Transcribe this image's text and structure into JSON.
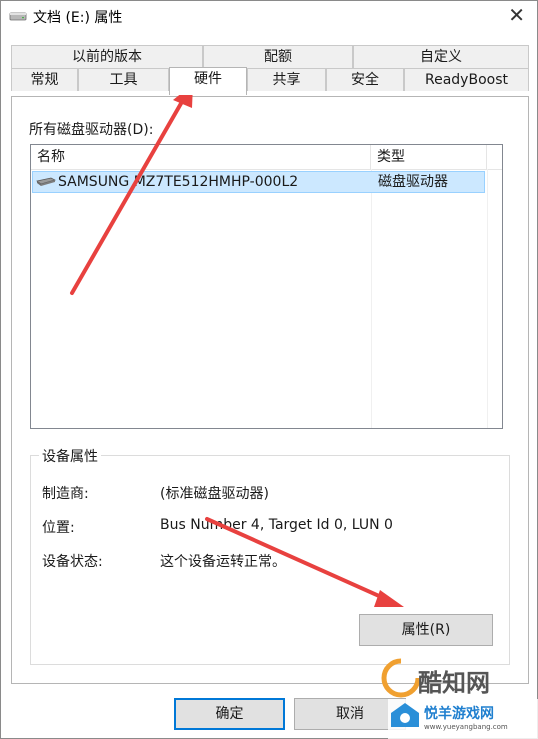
{
  "window": {
    "title": "文档 (E:) 属性",
    "close_glyph": "✕"
  },
  "tabs": {
    "row1": [
      {
        "label": "以前的版本"
      },
      {
        "label": "配额"
      },
      {
        "label": "自定义"
      }
    ],
    "row2": [
      {
        "label": "常规"
      },
      {
        "label": "工具"
      },
      {
        "label": "硬件",
        "active": true
      },
      {
        "label": "共享"
      },
      {
        "label": "安全"
      },
      {
        "label": "ReadyBoost"
      }
    ]
  },
  "hardware": {
    "drives_label": "所有磁盘驱动器(D):",
    "columns": [
      "名称",
      "类型"
    ],
    "rows": [
      {
        "name": "SAMSUNG MZ7TE512HMHP-000L2",
        "type": "磁盘驱动器",
        "icon": "disk-drive-icon",
        "selected": true
      }
    ],
    "device_properties": {
      "title": "设备属性",
      "manufacturer_label": "制造商:",
      "manufacturer_value": "(标准磁盘驱动器)",
      "location_label": "位置:",
      "location_value": "Bus Number 4, Target Id 0, LUN 0",
      "status_label": "设备状态:",
      "status_value": "这个设备运转正常。",
      "properties_button": "属性(R)"
    }
  },
  "footer": {
    "ok": "确定",
    "cancel": "取消"
  },
  "watermark": {
    "brand_text": "酷知网",
    "site_text": "悦羊游戏网",
    "url": "www.yueyangbang.com"
  },
  "colors": {
    "annotation_arrow": "#e8413f",
    "selection": "#cce8ff",
    "default_button_border": "#0078d7"
  }
}
